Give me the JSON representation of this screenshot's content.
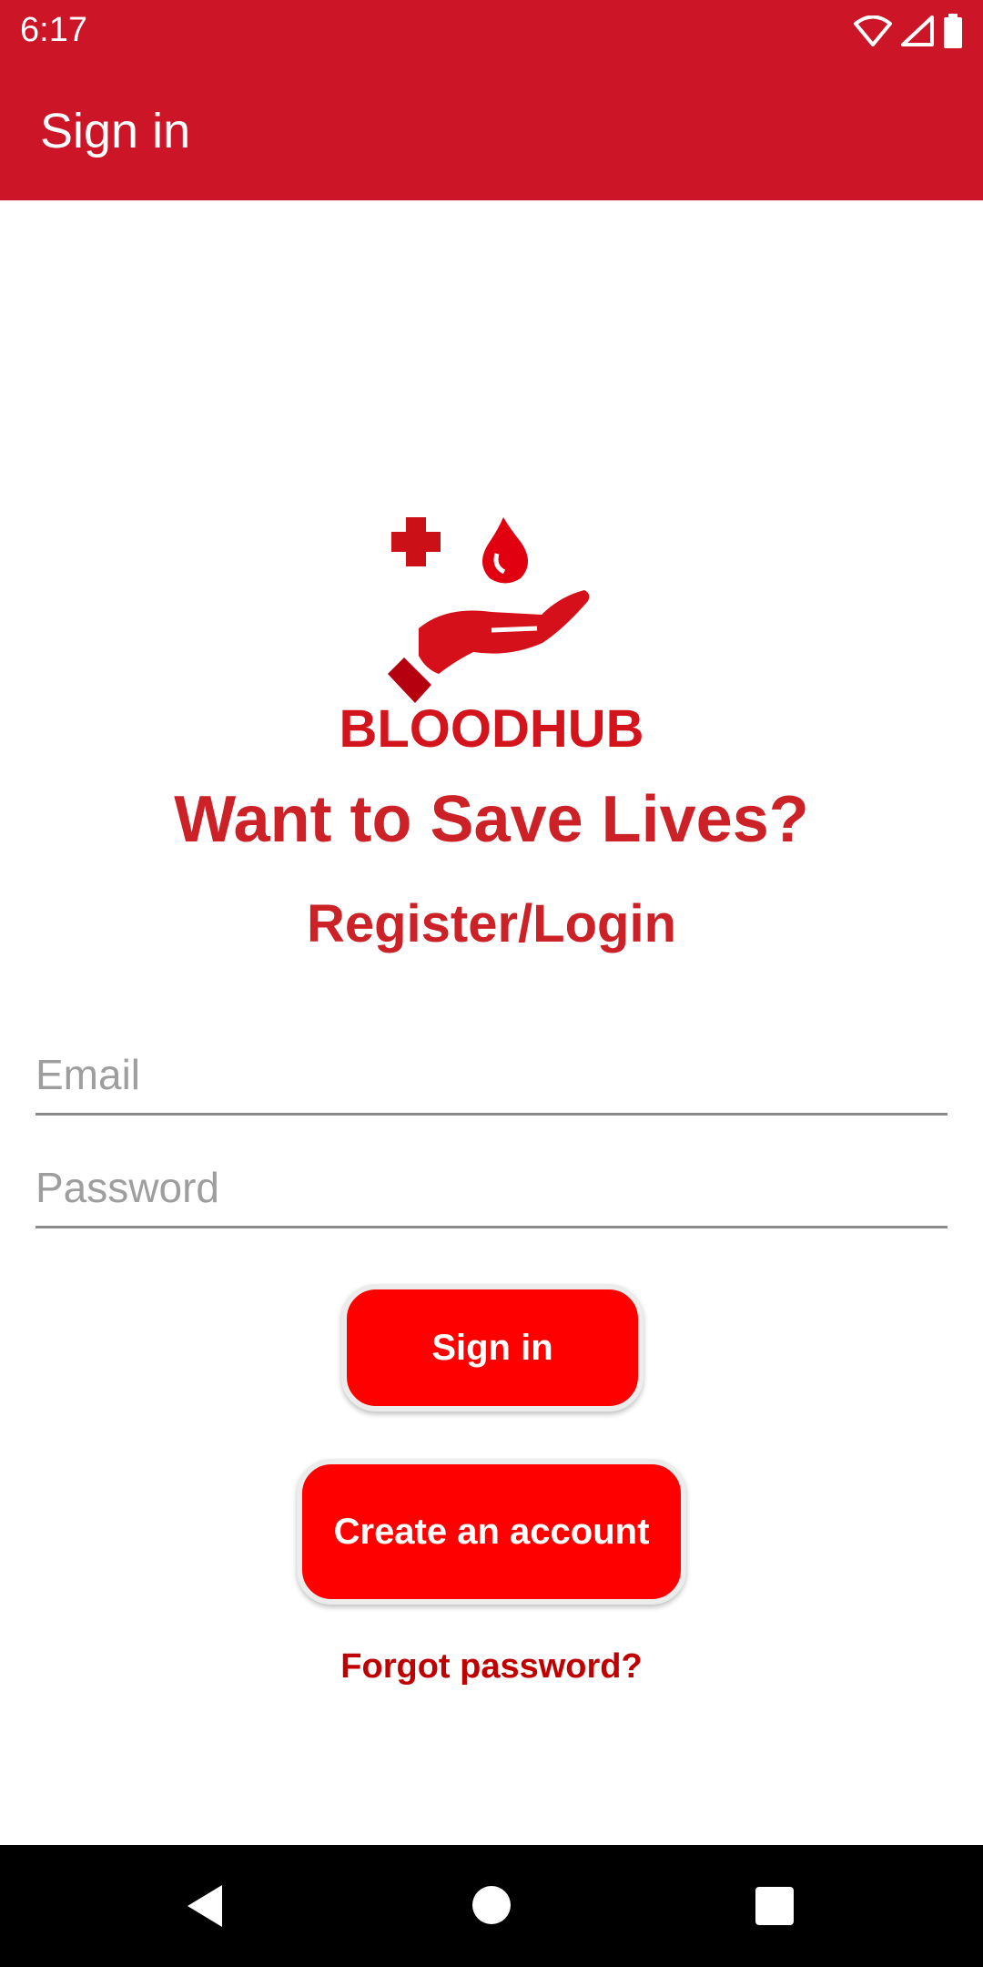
{
  "status_bar": {
    "time": "6:17",
    "icons": [
      "wifi-icon",
      "signal-icon",
      "battery-icon"
    ]
  },
  "app_bar": {
    "title": "Sign in"
  },
  "logo": {
    "brand": "BLOODHUB"
  },
  "headline": "Want to Save Lives?",
  "subheadline": "Register/Login",
  "form": {
    "email_placeholder": "Email",
    "password_placeholder": "Password",
    "signin_label": "Sign in",
    "create_account_label": "Create an account",
    "forgot_label": "Forgot password?"
  },
  "nav_bar": {
    "icons": [
      "back-icon",
      "home-icon",
      "recents-icon"
    ]
  },
  "colors": {
    "primary": "#cc1628",
    "button": "#ff0000",
    "text_accent": "#cc2127"
  }
}
